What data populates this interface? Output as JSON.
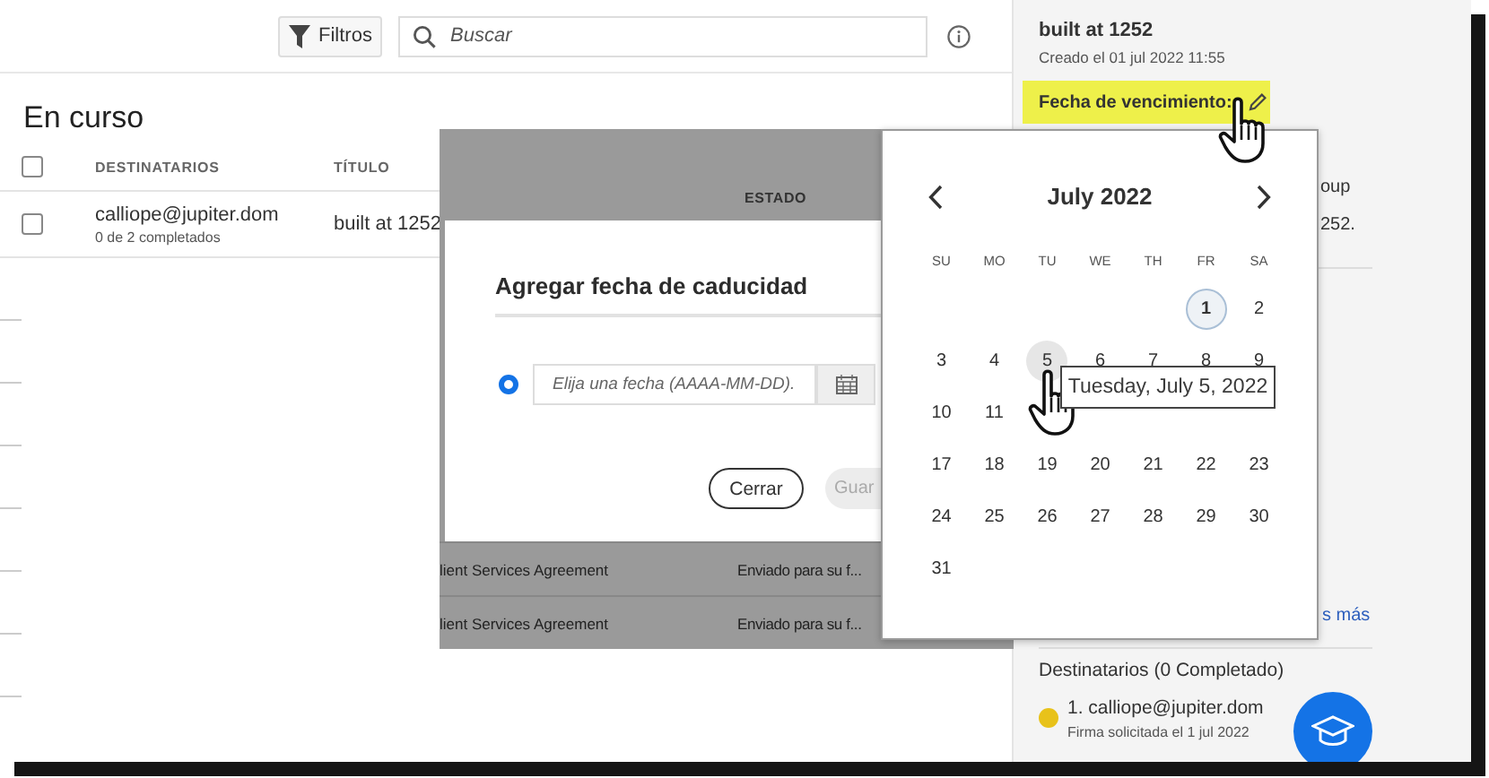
{
  "toolbar": {
    "filter_button": "Filtros",
    "search": {
      "placeholder": "Buscar"
    }
  },
  "section_title": "En curso",
  "table": {
    "columns": [
      "DESTINATARIOS",
      "TÍTULO"
    ],
    "header_checked": false,
    "rows": [
      {
        "recipient": "calliope@jupiter.dom",
        "progress": "0 de 2 completados",
        "title": "built at 1252",
        "checked": false
      }
    ]
  },
  "overlay_panel": {
    "column": "ESTADO",
    "rows": [
      {
        "title": "lient Services Agreement",
        "status": "Enviado para su f..."
      },
      {
        "title": "lient Services Agreement",
        "status": "Enviado para su f..."
      }
    ]
  },
  "dialog": {
    "title": "Agregar fecha de caducidad",
    "option_selected": true,
    "date_field": {
      "placeholder": "Elija una fecha (AAAA-MM-DD)."
    },
    "buttons": [
      {
        "label": "Cerrar",
        "disabled": false
      },
      {
        "label": "Guar",
        "disabled": true
      }
    ]
  },
  "date_picker": {
    "month": "July 2022",
    "weekdays": [
      "SU",
      "MO",
      "TU",
      "WE",
      "TH",
      "FR",
      "SA"
    ],
    "weeks": [
      {
        "days": [
          {
            "label": "1",
            "today": true,
            "hovered": false
          },
          {
            "label": "2",
            "today": false,
            "hovered": false
          }
        ]
      },
      {
        "days": [
          {
            "label": "3",
            "today": false,
            "hovered": false
          },
          {
            "label": "4",
            "today": false,
            "hovered": false
          },
          {
            "label": "5",
            "today": false,
            "hovered": true
          },
          {
            "label": "6",
            "today": false,
            "hovered": false
          },
          {
            "label": "7",
            "today": false,
            "hovered": false
          },
          {
            "label": "8",
            "today": false,
            "hovered": false
          },
          {
            "label": "9",
            "today": false,
            "hovered": false
          }
        ]
      },
      {
        "days": [
          {
            "label": "10",
            "today": false,
            "hovered": false
          },
          {
            "label": "11",
            "today": false,
            "hovered": false
          }
        ]
      },
      {
        "days": [
          {
            "label": "17",
            "today": false,
            "hovered": false
          },
          {
            "label": "18",
            "today": false,
            "hovered": false
          },
          {
            "label": "19",
            "today": false,
            "hovered": false
          },
          {
            "label": "20",
            "today": false,
            "hovered": false
          },
          {
            "label": "21",
            "today": false,
            "hovered": false
          },
          {
            "label": "22",
            "today": false,
            "hovered": false
          },
          {
            "label": "23",
            "today": false,
            "hovered": false
          }
        ]
      },
      {
        "days": [
          {
            "label": "24",
            "today": false,
            "hovered": false
          },
          {
            "label": "25",
            "today": false,
            "hovered": false
          },
          {
            "label": "26",
            "today": false,
            "hovered": false
          },
          {
            "label": "27",
            "today": false,
            "hovered": false
          },
          {
            "label": "28",
            "today": false,
            "hovered": false
          },
          {
            "label": "29",
            "today": false,
            "hovered": false
          },
          {
            "label": "30",
            "today": false,
            "hovered": false
          }
        ]
      },
      {
        "days": [
          {
            "label": "31",
            "today": false,
            "hovered": false
          }
        ]
      }
    ],
    "tooltip": "Tuesday, July 5, 2022"
  },
  "details": {
    "title": "built at 1252",
    "created": "Creado el 01 jul 2022 11:55",
    "due_label": "Fecha de vencimiento:",
    "due_highlighted": true,
    "partial_lines": [
      "oup",
      "252."
    ],
    "more_link": "s más",
    "recipients_heading": "Destinatarios (0 Completado)",
    "recipients": [
      {
        "name": "1. calliope@jupiter.dom",
        "status": "Firma solicitada el 1 jul 2022",
        "color": "#e8c21a"
      }
    ]
  }
}
